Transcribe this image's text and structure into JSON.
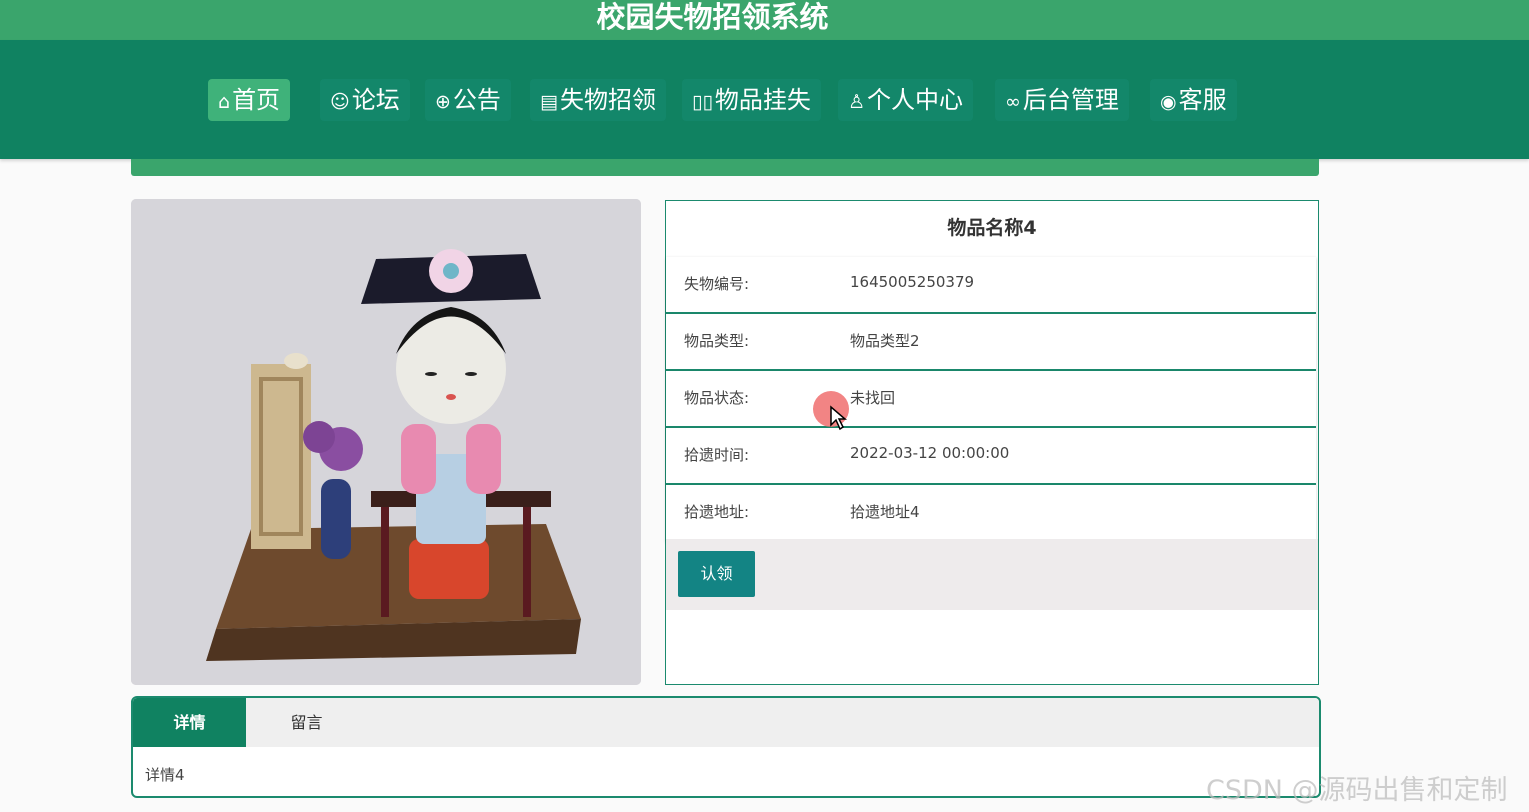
{
  "header": {
    "site_title": "校园失物招领系统"
  },
  "nav": {
    "items": [
      {
        "icon": "⌂",
        "label": "首页"
      },
      {
        "icon": "☺",
        "label": "论坛"
      },
      {
        "icon": "⊕",
        "label": "公告"
      },
      {
        "icon": "▤",
        "label": "失物招领"
      },
      {
        "icon": "▯▯",
        "label": "物品挂失"
      },
      {
        "icon": "♙",
        "label": "个人中心"
      },
      {
        "icon": "∞",
        "label": "后台管理"
      },
      {
        "icon": "◉",
        "label": "客服"
      }
    ]
  },
  "item": {
    "name": "物品名称4",
    "fields": [
      {
        "label": "失物编号:",
        "value": "1645005250379"
      },
      {
        "label": "物品类型:",
        "value": "物品类型2"
      },
      {
        "label": "物品状态:",
        "value": "未找回"
      },
      {
        "label": "拾遗时间:",
        "value": "2022-03-12 00:00:00"
      },
      {
        "label": "拾遗地址:",
        "value": "拾遗地址4"
      }
    ],
    "claim_label": "认领"
  },
  "tabs": {
    "items": [
      {
        "label": "详情"
      },
      {
        "label": "留言"
      }
    ],
    "content": "详情4"
  },
  "watermark": "CSDN @源码出售和定制"
}
